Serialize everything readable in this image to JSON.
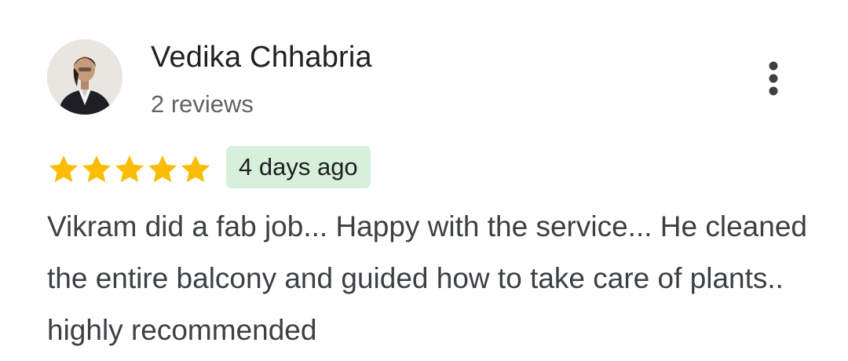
{
  "review": {
    "reviewer_name": "Vedika Chhabria",
    "review_count": "2 reviews",
    "rating": 5,
    "rating_max": 5,
    "date": "4 days ago",
    "text": "Vikram did a fab job... Happy with the service... He cleaned the entire balcony and guided how to take care of plants.. highly recommended"
  },
  "icons": {
    "avatar": "reviewer-photo",
    "menu": "more-vertical-icon",
    "star": "star-icon"
  },
  "colors": {
    "star": "#fbbc04",
    "badge_background": "#d6f0dc",
    "name_text": "#202124",
    "secondary_text": "#5f6368",
    "body_text": "#3c4043"
  }
}
